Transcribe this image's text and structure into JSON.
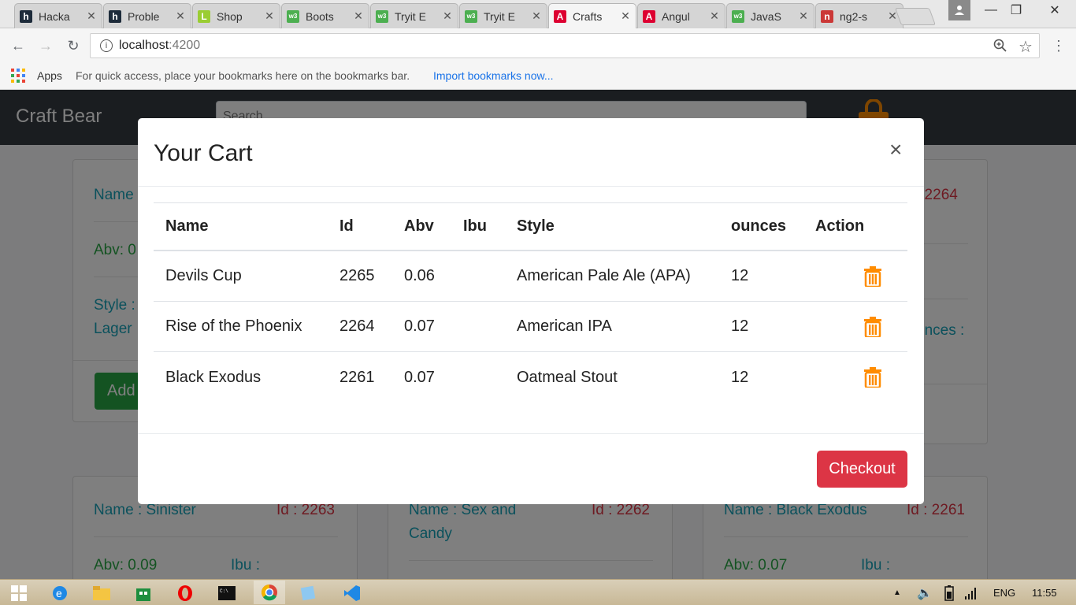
{
  "browser": {
    "tabs": [
      {
        "label": "Hacka",
        "favicon": "hackerrank-icon",
        "color": "#1d2b3a",
        "glyph": "h"
      },
      {
        "label": "Proble",
        "favicon": "hackerrank-icon",
        "color": "#1d2b3a",
        "glyph": "h"
      },
      {
        "label": "Shop",
        "favicon": "leaf-icon",
        "color": "#9acd32",
        "glyph": "L"
      },
      {
        "label": "Boots",
        "favicon": "w3schools-icon",
        "color": "#4caf50",
        "glyph": "w3"
      },
      {
        "label": "Tryit E",
        "favicon": "w3schools-icon",
        "color": "#4caf50",
        "glyph": "w3"
      },
      {
        "label": "Tryit E",
        "favicon": "w3schools-icon",
        "color": "#4caf50",
        "glyph": "w3"
      },
      {
        "label": "Crafts",
        "favicon": "angular-icon",
        "color": "#dd0031",
        "glyph": "A",
        "active": true
      },
      {
        "label": "Angul",
        "favicon": "angular-icon",
        "color": "#dd0031",
        "glyph": "A"
      },
      {
        "label": "JavaS",
        "favicon": "w3schools-icon",
        "color": "#4caf50",
        "glyph": "w3"
      },
      {
        "label": "ng2-s",
        "favicon": "npm-icon",
        "color": "#cb3837",
        "glyph": "n"
      }
    ],
    "address": {
      "host": "localhost",
      "port": ":4200"
    },
    "bookmarks": {
      "apps_label": "Apps",
      "hint": "For quick access, place your bookmarks here on the bookmarks bar.",
      "import_link": "Import bookmarks now..."
    }
  },
  "page": {
    "brand": "Craft Bear",
    "search_placeholder": "Search",
    "cards_top": {
      "left": {
        "name": "Name",
        "abv": "Abv: 0",
        "style1": "Style :",
        "style2": "Lager",
        "add": "Add"
      },
      "right": {
        "id": ": 2264",
        "ounces": "unces :"
      }
    },
    "cards_bottom": [
      {
        "name": "Name : Sinister",
        "id": "Id : 2263",
        "abv": "Abv: 0.09",
        "ibu": "Ibu :"
      },
      {
        "name": "Name : Sex and",
        "name2": "Candy",
        "id": "Id : 2262"
      },
      {
        "name": "Name : Black Exodus",
        "id": "Id : 2261",
        "abv": "Abv: 0.07",
        "ibu": "Ibu :"
      }
    ]
  },
  "modal": {
    "title": "Your Cart",
    "close": "×",
    "columns": {
      "name": "Name",
      "id": "Id",
      "abv": "Abv",
      "ibu": "Ibu",
      "style": "Style",
      "ounces": "ounces",
      "action": "Action"
    },
    "rows": [
      {
        "name": "Devils Cup",
        "id": "2265",
        "abv": "0.06",
        "ibu": "",
        "style": "American Pale Ale (APA)",
        "ounces": "12"
      },
      {
        "name": "Rise of the Phoenix",
        "id": "2264",
        "abv": "0.07",
        "ibu": "",
        "style": "American IPA",
        "ounces": "12"
      },
      {
        "name": "Black Exodus",
        "id": "2261",
        "abv": "0.07",
        "ibu": "",
        "style": "Oatmeal Stout",
        "ounces": "12"
      }
    ],
    "checkout_label": "Checkout",
    "trash_color": "#ff8c00"
  },
  "taskbar": {
    "language": "ENG",
    "time": "11:55"
  }
}
